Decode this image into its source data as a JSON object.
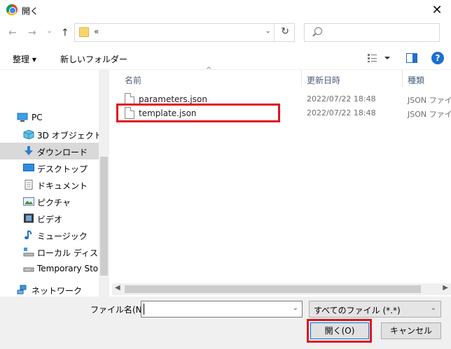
{
  "window": {
    "title": "開く",
    "close_glyph": "✕"
  },
  "navigation": {
    "back_glyph": "←",
    "forward_glyph": "→",
    "recent_glyph": "⌄",
    "up_glyph": "↑",
    "address_crumb": "«",
    "address_dropdown": "⌄",
    "refresh_glyph": "↻"
  },
  "toolbar": {
    "organize_label": "整理 ▾",
    "new_folder_label": "新しいフォルダー",
    "help_label": "?"
  },
  "sidebar": {
    "items": [
      {
        "label": "PC",
        "icon": "pc-icon"
      },
      {
        "label": "3D オブジェクト",
        "icon": "3d-objects-icon"
      },
      {
        "label": "ダウンロード",
        "icon": "download-icon"
      },
      {
        "label": "デスクトップ",
        "icon": "desktop-icon"
      },
      {
        "label": "ドキュメント",
        "icon": "documents-icon"
      },
      {
        "label": "ピクチャ",
        "icon": "pictures-icon"
      },
      {
        "label": "ビデオ",
        "icon": "video-icon"
      },
      {
        "label": "ミュージック",
        "icon": "music-icon"
      },
      {
        "label": "ローカル ディスク (C",
        "icon": "disk-icon"
      },
      {
        "label": "Temporary Stora",
        "icon": "drive-icon"
      },
      {
        "label": "ネットワーク",
        "icon": "network-icon"
      }
    ]
  },
  "file_list": {
    "columns": [
      "名前",
      "更新日時",
      "種類"
    ],
    "sort_glyph": "^",
    "rows": [
      {
        "name": "parameters.json",
        "modified": "2022/07/22 18:48",
        "type": "JSON ファイル"
      },
      {
        "name": "template.json",
        "modified": "2022/07/22 18:48",
        "type": "JSON ファイル"
      }
    ]
  },
  "footer": {
    "filename_label": "ファイル名(N):",
    "filename_value": "",
    "filetype_value": "すべてのファイル (*.*)",
    "open_label": "開く(O)",
    "cancel_label": "キャンセル"
  },
  "colors": {
    "highlight": "#e0141e",
    "selection": "#d9d9d9",
    "accent": "#0078d7"
  }
}
